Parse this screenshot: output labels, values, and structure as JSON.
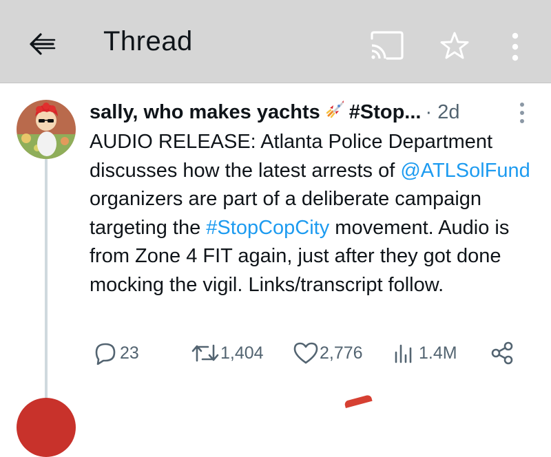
{
  "header": {
    "title": "Thread",
    "icons": {
      "back": "arrow-left-icon",
      "cast": "cast-icon",
      "favorite": "star-icon",
      "more": "more-vertical-icon"
    }
  },
  "tweet": {
    "author_name": "sally, who makes yachts",
    "author_tag": "#Stop...",
    "author_emoji_icon": "rocket-icon",
    "time": "· 2d",
    "body": [
      {
        "text": "AUDIO RELEASE: Atlanta Police Department discusses how the latest arrests of ",
        "link": false
      },
      {
        "text": "@ATLSolFund",
        "link": true
      },
      {
        "text": " organizers are part of a deliberate campaign targeting the ",
        "link": false
      },
      {
        "text": "#StopCopCity",
        "link": true
      },
      {
        "text": " movement. Audio is from Zone 4 FIT again, just after they got done mocking the vigil. Links/transcript follow.",
        "link": false
      }
    ],
    "actions": {
      "replies": "23",
      "retweets": "1,404",
      "likes": "2,776",
      "views": "1.4M"
    }
  },
  "colors": {
    "header_bg": "#d6d6d6",
    "link": "#1d9bf0",
    "muted": "#536471",
    "text": "#0f1419"
  }
}
